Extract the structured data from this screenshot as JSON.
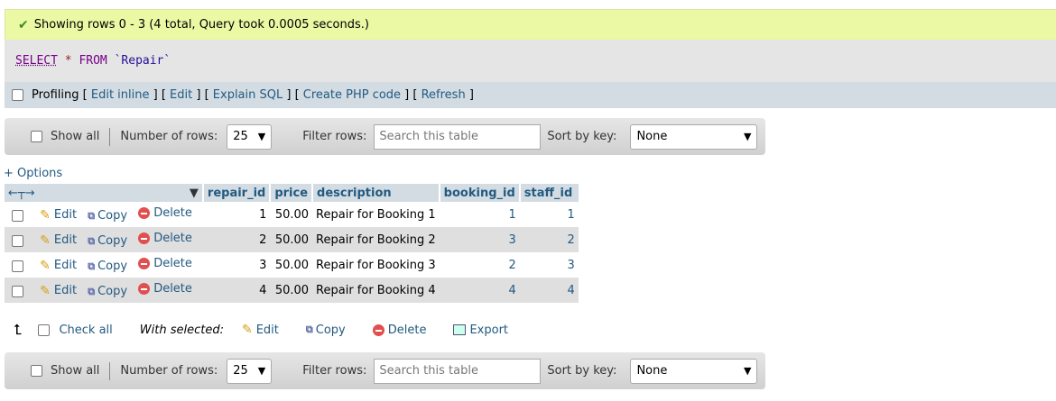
{
  "message": {
    "text": "Showing rows 0 - 3 (4 total, Query took 0.0005 seconds.)"
  },
  "sql": {
    "select": "SELECT",
    "star": "*",
    "from": "FROM",
    "table": "`Repair`"
  },
  "profiling": {
    "label": "Profiling",
    "links": [
      "Edit inline",
      "Edit",
      "Explain SQL",
      "Create PHP code",
      "Refresh"
    ]
  },
  "nav": {
    "show_all": "Show all",
    "rows_label": "Number of rows:",
    "rows_value": "25",
    "filter_label": "Filter rows:",
    "filter_placeholder": "Search this table",
    "sort_label": "Sort by key:",
    "sort_value": "None"
  },
  "options_link": "+ Options",
  "table": {
    "columns": [
      "repair_id",
      "price",
      "description",
      "booking_id",
      "staff_id"
    ],
    "actions": {
      "edit": "Edit",
      "copy": "Copy",
      "delete": "Delete"
    },
    "rows": [
      {
        "repair_id": "1",
        "price": "50.00",
        "description": "Repair for Booking 1",
        "booking_id": "1",
        "staff_id": "1"
      },
      {
        "repair_id": "2",
        "price": "50.00",
        "description": "Repair for Booking 2",
        "booking_id": "3",
        "staff_id": "2"
      },
      {
        "repair_id": "3",
        "price": "50.00",
        "description": "Repair for Booking 3",
        "booking_id": "2",
        "staff_id": "3"
      },
      {
        "repair_id": "4",
        "price": "50.00",
        "description": "Repair for Booking 4",
        "booking_id": "4",
        "staff_id": "4"
      }
    ]
  },
  "bulk": {
    "check_all": "Check all",
    "with_selected": "With selected:",
    "edit": "Edit",
    "copy": "Copy",
    "delete": "Delete",
    "export": "Export"
  }
}
